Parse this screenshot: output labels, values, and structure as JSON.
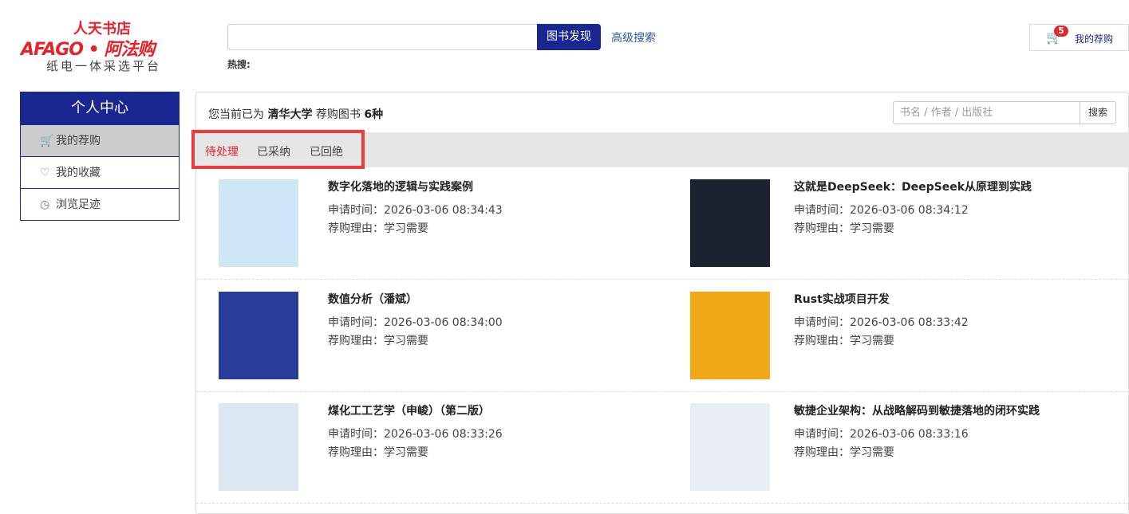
{
  "logo": {
    "line1": "人天书店",
    "line2": "AFAGO • 阿法购",
    "line3": "纸电一体采选平台"
  },
  "header": {
    "search_value": "",
    "search_button": "图书发现",
    "advanced": "高级搜索",
    "hot_label": "热搜:",
    "cart_count": "5",
    "cart_label": "我的荐购"
  },
  "sidebar": {
    "title": "个人中心",
    "items": [
      {
        "icon": "cart-icon",
        "label": "我的荐购",
        "active": true
      },
      {
        "icon": "heart-icon",
        "label": "我的收藏"
      },
      {
        "icon": "clock-icon",
        "label": "浏览足迹"
      }
    ]
  },
  "main": {
    "info_prefix": "您当前已为",
    "org": "清华大学",
    "info_mid": "荐购图书",
    "count": "6种",
    "search_placeholder": "书名 / 作者 / 出版社",
    "search_button": "搜索",
    "tabs": [
      {
        "label": "待处理",
        "active": true
      },
      {
        "label": "已采纳"
      },
      {
        "label": "已回绝"
      }
    ],
    "time_label": "申请时间：",
    "reason_label": "荐购理由：",
    "books": [
      {
        "title": "数字化落地的逻辑与实践案例",
        "time": "2026-03-06 08:34:43",
        "reason": "学习需要",
        "color": "#cfe6f7"
      },
      {
        "title": "这就是DeepSeek：DeepSeek从原理到实践",
        "time": "2026-03-06 08:34:12",
        "reason": "学习需要",
        "color": "#1b2230"
      },
      {
        "title": "数值分析（潘斌）",
        "time": "2026-03-06 08:34:00",
        "reason": "学习需要",
        "color": "#2a3c9a"
      },
      {
        "title": "Rust实战项目开发",
        "time": "2026-03-06 08:33:42",
        "reason": "学习需要",
        "color": "#f0a816"
      },
      {
        "title": "煤化工工艺学（申峻）（第二版）",
        "time": "2026-03-06 08:33:26",
        "reason": "学习需要",
        "color": "#dbe8f2"
      },
      {
        "title": "敏捷企业架构：从战略解码到敏捷落地的闭环实践",
        "time": "2026-03-06 08:33:16",
        "reason": "学习需要",
        "color": "#e8eef4"
      }
    ]
  },
  "colors": {
    "brand": "#1a2790",
    "accent": "#e8202a",
    "highlight": "#f23a3a"
  }
}
